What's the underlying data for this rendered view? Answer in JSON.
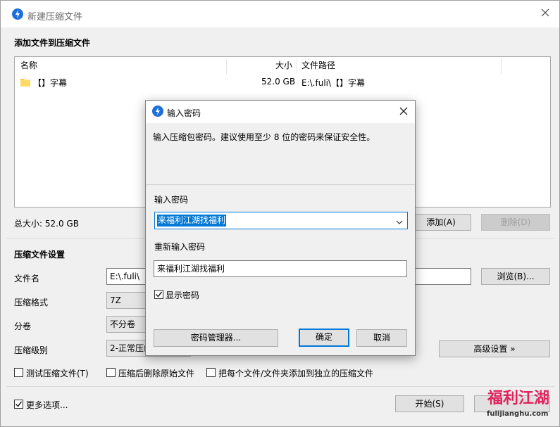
{
  "window": {
    "title": "新建压缩文件",
    "add_files_label": "添加文件到压缩文件",
    "columns": {
      "name": "名称",
      "size": "大小",
      "path": "文件路径"
    },
    "files": [
      {
        "name": "【】字幕",
        "size": "52.0 GB",
        "path": "E:\\.fuli\\【】字幕"
      }
    ],
    "total_size": "总大小: 52.0 GB",
    "add_button": "添加(A)",
    "delete_button": "删除(D)",
    "settings_label": "压缩文件设置",
    "filename_label": "文件名",
    "filename_value": "E:\\.fuli\\【",
    "browse_button": "浏览(B)...",
    "format_label": "压缩格式",
    "format_value": "7Z",
    "split_label": "分卷",
    "split_value": "不分卷",
    "level_label": "压缩级别",
    "level_value": "2-正常压缩",
    "advanced_button": "高级设置 »",
    "opt_test": "测试压缩文件(T)",
    "opt_delete_source": "压缩后删除原始文件",
    "opt_separate": "把每个文件/文件夹添加到独立的压缩文件",
    "more_options": "更多选项...",
    "start_button": "开始(S)"
  },
  "dialog": {
    "title": "输入密码",
    "description": "输入压缩包密码。建议使用至少 8 位的密码来保证安全性。",
    "password_label": "输入密码",
    "password_value": "来福利江湖找福利",
    "confirm_label": "重新输入密码",
    "confirm_value": "来福利江湖找福利",
    "show_password": "显示密码",
    "manager_button": "密码管理器...",
    "ok_button": "确定",
    "cancel_button": "取消"
  },
  "watermark": {
    "brand": "福利江湖",
    "site": "fulijianghu.com"
  },
  "colors": {
    "accent": "#0078d7",
    "app_icon": "#1e6fd9",
    "watermark_red": "#e0245e",
    "watermark_blue": "#1a8fd8"
  }
}
